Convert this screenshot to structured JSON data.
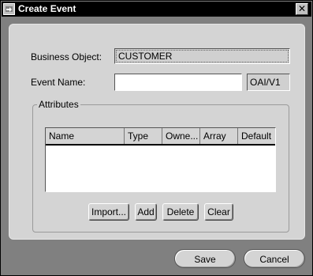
{
  "window": {
    "title": "Create Event",
    "close_glyph": "✕"
  },
  "form": {
    "business_object_label": "Business Object:",
    "business_object_value": "CUSTOMER",
    "event_name_label": "Event Name:",
    "event_name_value": "",
    "event_name_placeholder": "",
    "namespace_value": "OAI/V1"
  },
  "attributes": {
    "group_label": "Attributes",
    "columns": [
      "Name",
      "Type",
      "Owne...",
      "Array",
      "Default"
    ],
    "rows": [],
    "buttons": {
      "import": "Import...",
      "add": "Add",
      "delete": "Delete",
      "clear": "Clear"
    }
  },
  "footer": {
    "save": "Save",
    "cancel": "Cancel"
  }
}
